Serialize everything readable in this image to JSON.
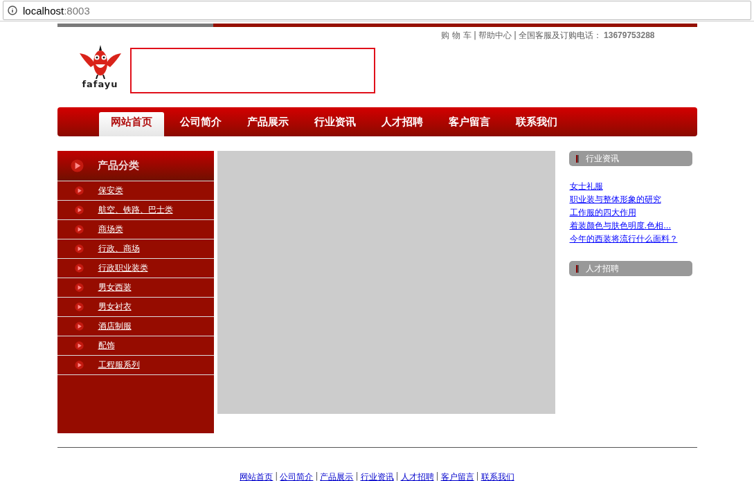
{
  "browser": {
    "url_host": "localhost",
    "url_port": ":8003"
  },
  "top_links": {
    "separator": "|",
    "items": [
      {
        "label": "购 物 车",
        "kind": "link"
      },
      {
        "label": "帮助中心",
        "kind": "link"
      },
      {
        "label": "全国客服及订购电话：",
        "kind": "text"
      }
    ],
    "phone": "13679753288"
  },
  "logo": {
    "text": "fafayu"
  },
  "nav": [
    {
      "label": "网站首页",
      "selected": true
    },
    {
      "label": "公司简介",
      "selected": false
    },
    {
      "label": "产品展示",
      "selected": false
    },
    {
      "label": "行业资讯",
      "selected": false
    },
    {
      "label": "人才招聘",
      "selected": false
    },
    {
      "label": "客户留言",
      "selected": false
    },
    {
      "label": "联系我们",
      "selected": false
    }
  ],
  "sidebar": {
    "title": "产品分类",
    "items": [
      "保安类",
      "航空、铁路、巴士类",
      "商场类",
      "行政、商场",
      "行政职业装类",
      "男女西装",
      "男女衬衣",
      "酒店制服",
      "配饰",
      "工程服系列"
    ]
  },
  "right": {
    "sections": [
      {
        "title": "行业资讯",
        "links": [
          "女士礼服",
          "职业装与整体形象的研究",
          "工作服的四大作用",
          "着装颜色与肤色明度.色相...",
          "今年的西装将流行什么面料？"
        ]
      },
      {
        "title": "人才招聘"
      }
    ]
  },
  "footer": {
    "separator": "|",
    "links": [
      "网站首页",
      "公司简介",
      "产品展示",
      "行业资讯",
      "人才招聘",
      "客户留言",
      "联系我们"
    ]
  }
}
